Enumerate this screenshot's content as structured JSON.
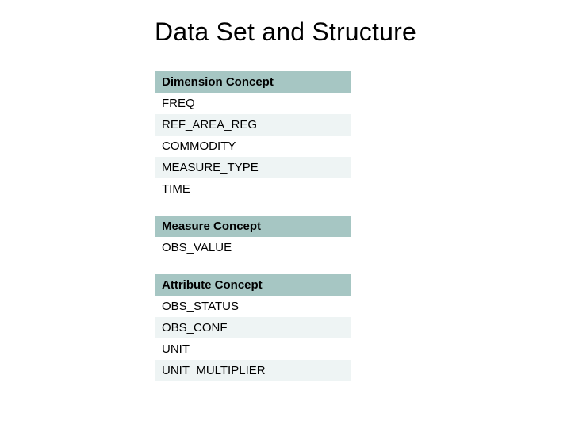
{
  "title": "Data Set and Structure",
  "dimension": {
    "header": "Dimension Concept",
    "rows": [
      "FREQ",
      "REF_AREA_REG",
      "COMMODITY",
      "MEASURE_TYPE",
      "TIME"
    ]
  },
  "measure": {
    "header": "Measure Concept",
    "rows": [
      "OBS_VALUE"
    ]
  },
  "attribute": {
    "header": "Attribute Concept",
    "rows": [
      "OBS_STATUS",
      "OBS_CONF",
      "UNIT",
      "UNIT_MULTIPLIER"
    ]
  }
}
